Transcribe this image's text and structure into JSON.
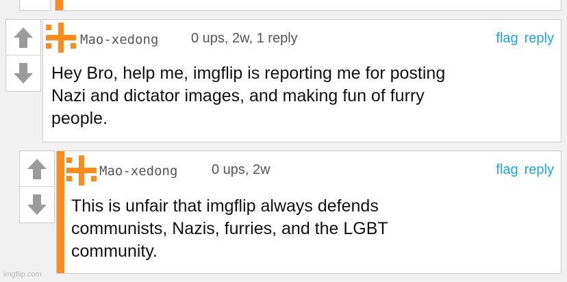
{
  "colors": {
    "accent": "#ff8c1a",
    "link": "#1aa3e8",
    "meta": "#555555",
    "border": "#cccccc",
    "background": "#f1f1f1"
  },
  "icons": {
    "upvote": "up-arrow-icon",
    "downvote": "down-arrow-icon",
    "avatar": "orange-cross-avatar-icon"
  },
  "comments": [
    {
      "username": "Mao-xedong",
      "meta": "0 ups, 2w, 1 reply",
      "flag_label": "flag",
      "reply_label": "reply",
      "text_lines": [
        "Hey Bro, help me, imgflip is reporting me for posting",
        "Nazi and dictator images, and making fun of furry",
        "people."
      ]
    },
    {
      "username": "Mao-xedong",
      "meta": "0 ups, 2w",
      "flag_label": "flag",
      "reply_label": "reply",
      "text_lines": [
        "This is unfair that imgflip always defends",
        "communists, Nazis, furries, and the LGBT",
        "community."
      ]
    }
  ],
  "watermark": "imgflip.com"
}
